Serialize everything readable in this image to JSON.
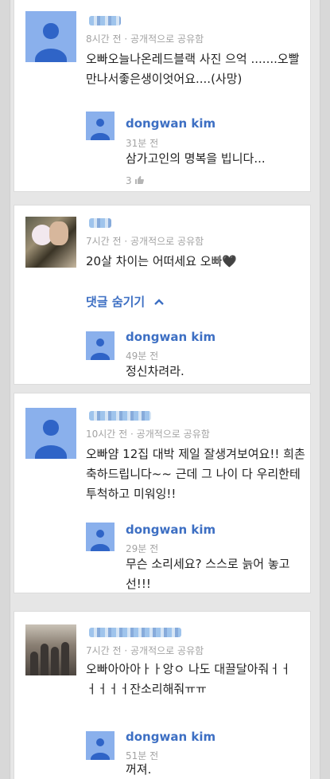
{
  "comments": [
    {
      "meta": "8시간 전 · 공개적으로 공유함",
      "text_lines": [
        "오빠오늘나온레드블랙 사진 으억 .......오빨",
        "만나서좋은생이엇어요....(사망)"
      ],
      "reply": {
        "name": "dongwan kim",
        "time": "31분 전",
        "text_lines": [
          "삼가고인의 명복을 빕니다..."
        ],
        "likes": "3"
      }
    },
    {
      "meta": "7시간 전 · 공개적으로 공유함",
      "text_lines": [
        "20살 차이는 어떠세요 오빠🖤"
      ],
      "hide_replies": "댓글 숨기기",
      "reply": {
        "name": "dongwan kim",
        "time": "49분 전",
        "text_lines": [
          "정신차려라."
        ]
      }
    },
    {
      "meta": "10시간 전 · 공개적으로 공유함",
      "text_lines": [
        "오빠얌 12집 대박 제일 잘생겨보여요!! 희촌",
        "축하드립니다~~ 근데 그 나이 다 우리한테",
        "투척하고 미워잉!!"
      ],
      "reply": {
        "name": "dongwan kim",
        "time": "29분 전",
        "text_lines": [
          "무슨 소리세요? 스스로 늙어 놓고",
          "선!!!"
        ]
      }
    },
    {
      "meta": "7시간 전 · 공개적으로 공유함",
      "text_lines": [
        "오빠아아아ㅏㅏ앙ㅇ 나도 대끌달아줘ㅓㅓ",
        "ㅓㅓㅓㅓ잔소리해줘ㅠㅠ"
      ],
      "reply": {
        "name": "dongwan kim",
        "time": "51분 전",
        "text_lines": [
          "꺼져."
        ]
      }
    }
  ],
  "icons": {
    "thumbs_up": "thumbs-up-icon",
    "chevron_up": "chevron-up-icon",
    "default_avatar": "person-icon"
  },
  "colors": {
    "link": "#3d6fc3",
    "avatar_bg": "#8ab0ec",
    "avatar_fg": "#2f64c7"
  }
}
